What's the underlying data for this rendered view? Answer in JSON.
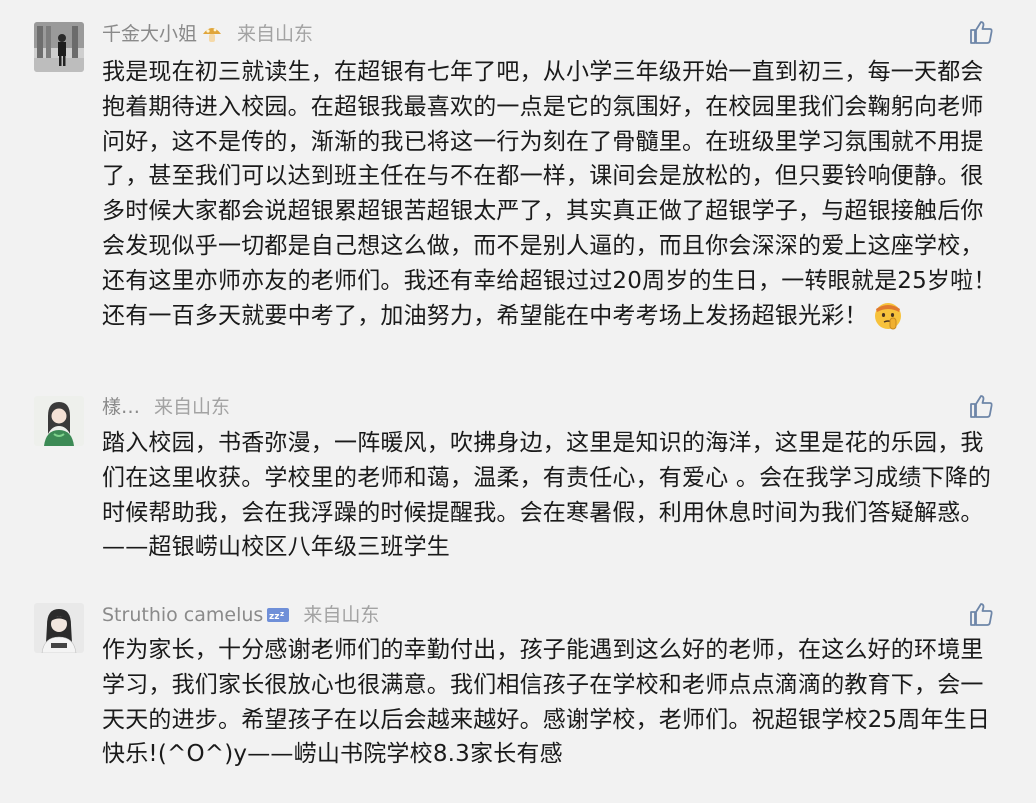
{
  "comments": [
    {
      "nickname": "千金大小姐",
      "nickname_badge": "mushroom-emoji",
      "location": "来自山东",
      "text": "我是现在初三就读生，在超银有七年了吧，从小学三年级开始一直到初三，每一天都会抱着期待进入校园。在超银我最喜欢的一点是它的氛围好，在校园里我们会鞠躬向老师问好，这不是传的，渐渐的我已将这一行为刻在了骨髓里。在班级里学习氛围就不用提了，甚至我们可以达到班主任在与不在都一样，课间会是放松的，但只要铃响便静。很多时候大家都会说超银累超银苦超银太严了，其实真正做了超银学子，与超银接触后你会发现似乎一切都是自己想这么做，而不是别人逼的，而且你会深深的爱上这座学校，还有这里亦师亦友的老师们。我还有幸给超银过过20周岁的生日，一转眼就是25岁啦！还有一百多天就要中考了，加油努力，希望能在中考考场上发扬超银光彩！",
      "trailing_emoji": "shushing-face-emoji"
    },
    {
      "nickname": "樣…",
      "nickname_badge": "",
      "location": "来自山东",
      "text": "踏入校园，书香弥漫，一阵暖风，吹拂身边，这里是知识的海洋，这里是花的乐园，我们在这里收获。学校里的老师和蔼，温柔，有责任心，有爱心 。会在我学习成绩下降的时候帮助我，会在我浮躁的时候提醒我。会在寒暑假，利用休息时间为我们答疑解惑。——超银崂山校区八年级三班学生",
      "trailing_emoji": ""
    },
    {
      "nickname": "Struthio camelus",
      "nickname_badge": "zzz-emoji",
      "location": "来自山东",
      "text": "作为家长，十分感谢老师们的幸勤付出，孩子能遇到这么好的老师，在这么好的环境里学习，我们家长很放心也很满意。我们相信孩子在学校和老师点点滴滴的教育下，会一天天的进步。希望孩子在以后会越来越好。感谢学校，老师们。祝超银学校25周年生日快乐!(^O^)y——崂山书院学校8.3家长有感",
      "trailing_emoji": ""
    }
  ],
  "icons": {
    "like": "thumbs-up-icon"
  },
  "colors": {
    "background": "#f2f2f2",
    "text": "#1a1a1a",
    "meta": "#8a8a8a",
    "icon": "#6e86a8"
  }
}
